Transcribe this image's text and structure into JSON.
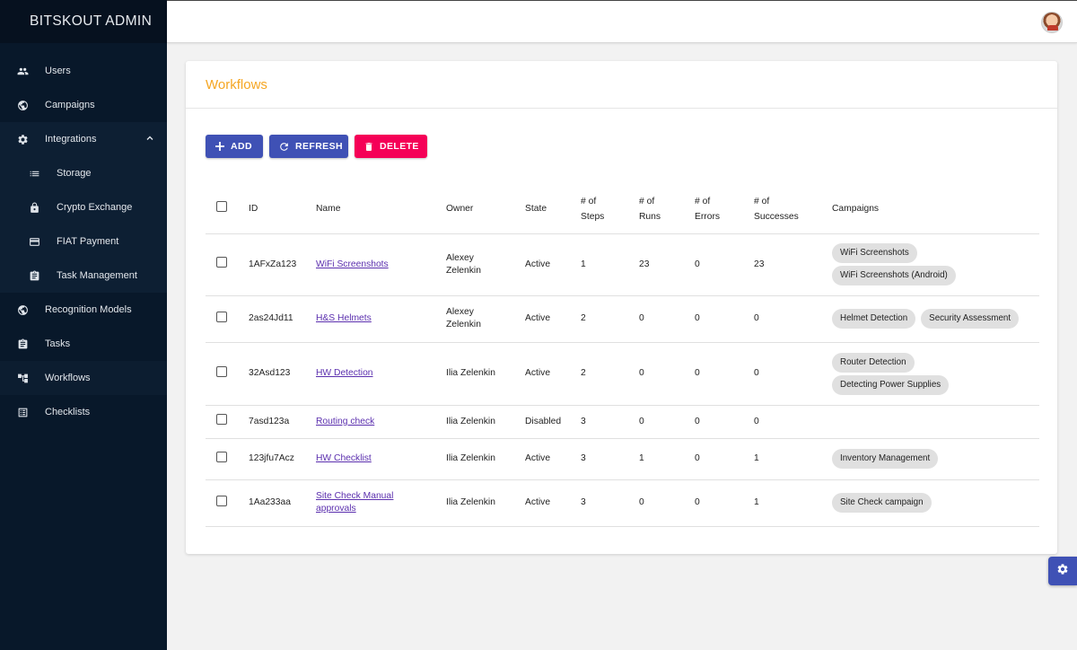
{
  "app": {
    "brand": "BITSKOUT ADMIN"
  },
  "sidebar": {
    "items": [
      {
        "label": "Users",
        "icon": "people-icon"
      },
      {
        "label": "Campaigns",
        "icon": "globe-icon"
      },
      {
        "label": "Integrations",
        "icon": "gear-icon",
        "expanded": true
      },
      {
        "label": "Storage",
        "icon": "list-icon",
        "sub": true
      },
      {
        "label": "Crypto Exchange",
        "icon": "lock-icon",
        "sub": true
      },
      {
        "label": "FIAT Payment",
        "icon": "card-icon",
        "sub": true
      },
      {
        "label": "Task Management",
        "icon": "clipboard-icon",
        "sub": true
      },
      {
        "label": "Recognition Models",
        "icon": "globe-icon"
      },
      {
        "label": "Tasks",
        "icon": "clipboard-icon"
      },
      {
        "label": "Workflows",
        "icon": "hierarchy-icon",
        "active": true
      },
      {
        "label": "Checklists",
        "icon": "list-alt-icon"
      }
    ]
  },
  "page": {
    "title": "Workflows",
    "buttons": {
      "add": "ADD",
      "refresh": "REFRESH",
      "delete": "DELETE"
    },
    "table": {
      "headers": {
        "id": "ID",
        "name": "Name",
        "owner": "Owner",
        "state": "State",
        "steps": [
          "# of",
          "Steps"
        ],
        "runs": [
          "# of",
          "Runs"
        ],
        "errors": [
          "# of",
          "Errors"
        ],
        "successes": [
          "# of",
          "Successes"
        ],
        "campaigns": "Campaigns"
      },
      "rows": [
        {
          "id": "1AFxZa123",
          "name": [
            "WiFi Screenshots"
          ],
          "owner": [
            "Alexey",
            "Zelenkin"
          ],
          "state": "Active",
          "steps": "1",
          "runs": "23",
          "errors": "0",
          "successes": "23",
          "campaigns": [
            "WiFi Screenshots",
            "WiFi Screenshots (Android)"
          ]
        },
        {
          "id": "2as24Jd11",
          "name": [
            "H&S Helmets"
          ],
          "owner": [
            "Alexey",
            "Zelenkin"
          ],
          "state": "Active",
          "steps": "2",
          "runs": "0",
          "errors": "0",
          "successes": "0",
          "campaigns": [
            "Helmet Detection",
            "Security Assessment"
          ]
        },
        {
          "id": "32Asd123",
          "name": [
            "HW Detection"
          ],
          "owner": [
            "Ilia Zelenkin"
          ],
          "state": "Active",
          "steps": "2",
          "runs": "0",
          "errors": "0",
          "successes": "0",
          "campaigns": [
            "Router Detection",
            "Detecting Power Supplies"
          ]
        },
        {
          "id": "7asd123a",
          "name": [
            "Routing check"
          ],
          "owner": [
            "Ilia Zelenkin"
          ],
          "state": "Disabled",
          "steps": "3",
          "runs": "0",
          "errors": "0",
          "successes": "0",
          "campaigns": []
        },
        {
          "id": "123jfu7Acz",
          "name": [
            "HW Checklist"
          ],
          "owner": [
            "Ilia Zelenkin"
          ],
          "state": "Active",
          "steps": "3",
          "runs": "1",
          "errors": "0",
          "successes": "1",
          "campaigns": [
            "Inventory Management"
          ]
        },
        {
          "id": "1Aa233aa",
          "name": [
            "Site Check Manual",
            "approvals"
          ],
          "owner": [
            "Ilia Zelenkin"
          ],
          "state": "Active",
          "steps": "3",
          "runs": "0",
          "errors": "0",
          "successes": "1",
          "campaigns": [
            "Site Check campaign"
          ]
        }
      ]
    }
  },
  "colors": {
    "sidebar": "#08182a",
    "accent": "#3f51b5",
    "danger": "#f50057",
    "title": "#f5a623"
  }
}
